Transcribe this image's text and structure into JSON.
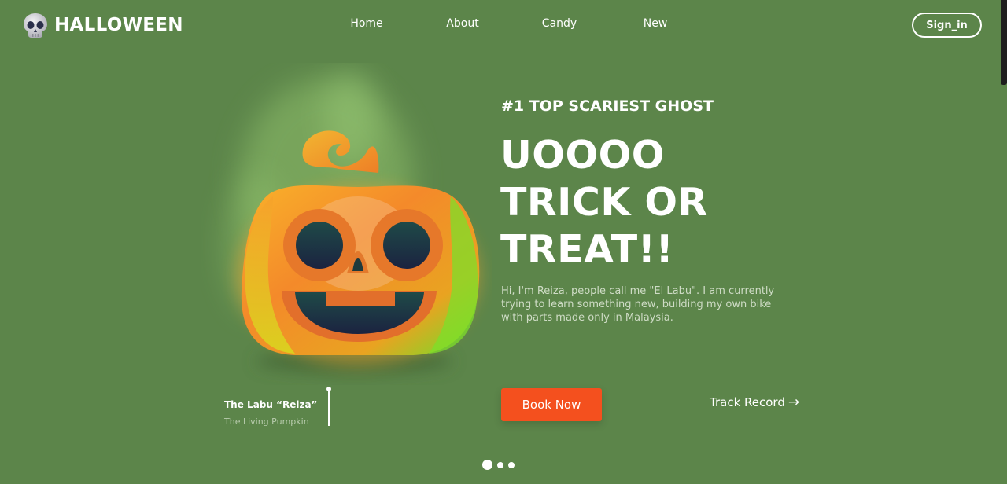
{
  "brand": {
    "name": "HALLOWEEN",
    "logo_icon": "skull-icon"
  },
  "nav": {
    "items": [
      "Home",
      "About",
      "Candy",
      "New"
    ]
  },
  "header": {
    "signin_label": "Sign_in"
  },
  "hero": {
    "eyebrow": "#1 TOP SCARIEST GHOST",
    "headline_lines": [
      "UOOOO",
      "TRICK OR",
      "TREAT!!"
    ],
    "description": "Hi, I'm Reiza, people call me \"El Labu\". I am currently trying to learn something new, building my own bike with parts made only in Malaysia.",
    "book_label": "Book Now",
    "track_label": "Track Record",
    "track_icon": "arrow-right-icon"
  },
  "caption": {
    "title": "The Labu “Reiza”",
    "subtitle": "The Living Pumpkin"
  },
  "carousel": {
    "count": 3,
    "active": 0
  },
  "colors": {
    "background": "#5c854a",
    "accent": "#f4501e",
    "text": "#ffffff"
  }
}
